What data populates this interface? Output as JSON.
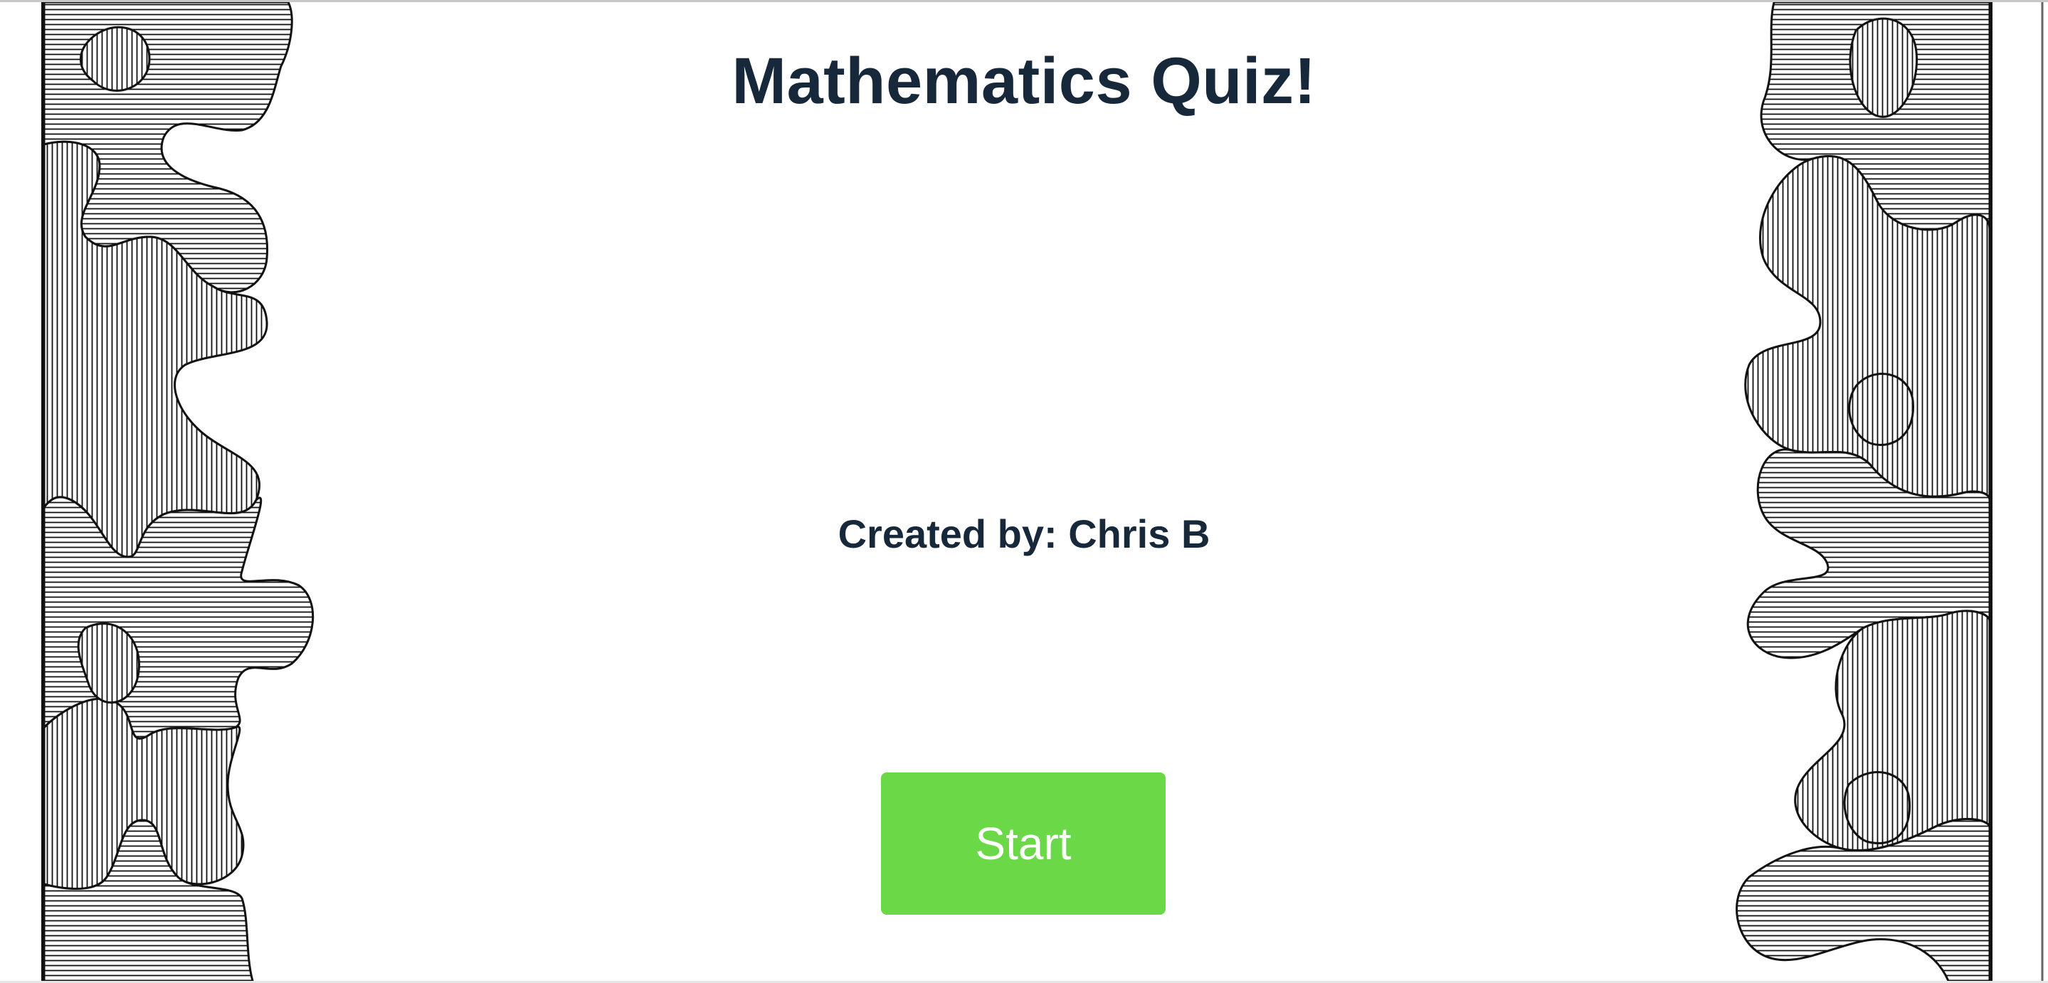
{
  "quiz": {
    "title": "Mathematics Quiz!",
    "credit": "Created by: Chris B",
    "start_label": "Start"
  },
  "decoration": {
    "left_border_icon": "jigsaw-puzzle-border",
    "right_border_icon": "jigsaw-puzzle-border"
  },
  "colors": {
    "text": "#17283a",
    "button_background": "#6bd848",
    "button_text": "#ffffff",
    "background": "#ffffff"
  }
}
